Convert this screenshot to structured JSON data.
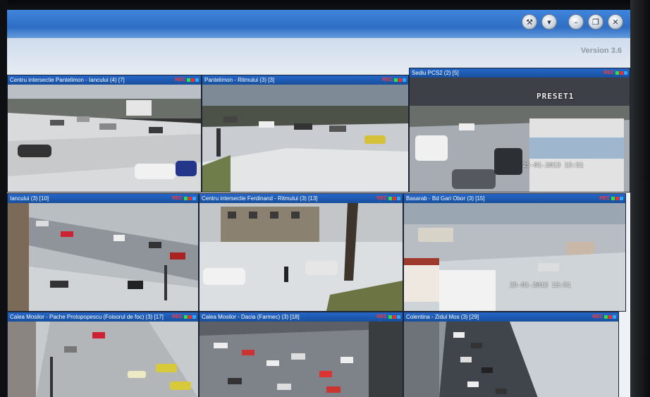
{
  "window": {
    "version": "Version 3.6",
    "buttons": [
      "wrench-icon",
      "chevron-down-icon",
      "minimize-icon",
      "restore-icon",
      "close-icon"
    ]
  },
  "cameras": [
    {
      "title": "Centru intersectie Pantelimon - Iancului (4) [7]",
      "rec": "REC",
      "colors": {
        "sky": "#b9bfc4",
        "ground": "#d9dadb"
      }
    },
    {
      "title": "Pantelimon - Ritmului (3) [3]",
      "rec": "REC",
      "colors": {
        "sky": "#7e8a95",
        "ground": "#c9cdd1"
      }
    },
    {
      "title": "Sediu PCS2 (2) [5]",
      "rec": "REC",
      "overlay": "PRESET1",
      "date": "25-01-2013 13:51",
      "colors": {
        "sky": "#3d4047",
        "ground": "#a7acb2"
      }
    },
    {
      "title": "Iancului (3) [10]",
      "rec": "REC",
      "colors": {
        "sky": "#a8b0b6",
        "ground": "#b9bec3"
      }
    },
    {
      "title": "Centru intersectie Ferdinand - Ritmului (3) [13]",
      "rec": "REC",
      "colors": {
        "sky": "#c2c6c9",
        "ground": "#dcdfe1"
      }
    },
    {
      "title": "Basarab - Bd Gari Obor (3) [15]",
      "rec": "REC",
      "date": "25-01-2013 13:51",
      "colors": {
        "sky": "#9aa6b2",
        "ground": "#cfd4d8"
      }
    },
    {
      "title": "Calea Mosilor - Pache Protopopescu (Foisorul de foc) (3) [17]",
      "rec": "REC",
      "colors": {
        "sky": "#b3b6b8",
        "ground": "#c8cbce"
      }
    },
    {
      "title": "Calea Mosilor - Dacia (Farmec) (3) [18]",
      "rec": "REC",
      "colors": {
        "sky": "#5c6066",
        "ground": "#7e8389"
      }
    },
    {
      "title": "Colentina - Zidul Mos (3) [29]",
      "rec": "REC",
      "colors": {
        "sky": "#9ea6ad",
        "ground": "#8d949a"
      }
    }
  ]
}
